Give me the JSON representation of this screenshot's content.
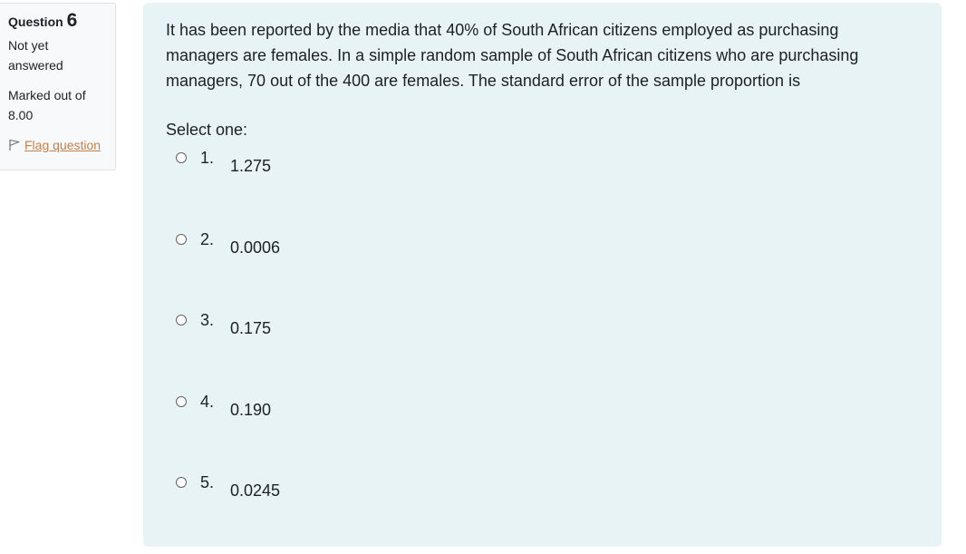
{
  "info": {
    "question_label": "Question",
    "question_number": "6",
    "status_line1": "Not yet",
    "status_line2": "answered",
    "grade_line1": "Marked out of",
    "grade_line2": "8.00",
    "flag_label": "Flag question",
    "flag_icon": "flag-outline-icon"
  },
  "question": {
    "text": "It has been reported by the media that 40% of South African citizens employed as purchasing managers are females.  In a simple random sample of South African citizens who are purchasing managers, 70 out of the 400 are females. The standard error of the sample proportion is",
    "prompt": "Select one:",
    "answers": [
      {
        "number": "1.",
        "text": "1.275"
      },
      {
        "number": "2.",
        "text": "0.0006"
      },
      {
        "number": "3.",
        "text": "0.175"
      },
      {
        "number": "4.",
        "text": "0.190"
      },
      {
        "number": "5.",
        "text": "0.0245"
      }
    ]
  },
  "colors": {
    "content_bg": "#e7f3f5",
    "info_bg": "#f8f9fa",
    "flag_link": "#c4804a"
  }
}
